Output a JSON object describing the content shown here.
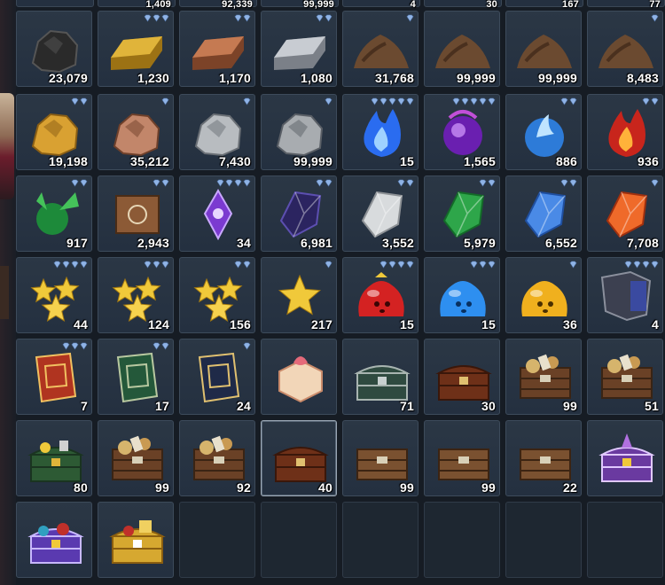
{
  "colors": {
    "slot_bg": "#243040",
    "slot_border": "#3d4b5b",
    "gem": "#8fb3e6",
    "qty": "#ffffff"
  },
  "top_partial": [
    "1,409",
    "92,339",
    "99,999",
    "4",
    "30",
    "167",
    "77"
  ],
  "rows": [
    [
      {
        "icon": "coal-ore-icon",
        "gems": 0,
        "qty": "23,079"
      },
      {
        "icon": "gold-ingot-icon",
        "gems": 3,
        "qty": "1,230"
      },
      {
        "icon": "copper-ingot-icon",
        "gems": 2,
        "qty": "1,170"
      },
      {
        "icon": "silver-ingot-icon",
        "gems": 2,
        "qty": "1,080"
      },
      {
        "icon": "dirt-pile-icon",
        "gems": 1,
        "qty": "31,768"
      },
      {
        "icon": "dirt-pile-icon",
        "gems": 0,
        "qty": "99,999"
      },
      {
        "icon": "dirt-pile-icon",
        "gems": 0,
        "qty": "99,999"
      },
      {
        "icon": "dirt-pile-icon",
        "gems": 1,
        "qty": "8,483"
      }
    ],
    [
      {
        "icon": "gold-ore-icon",
        "gems": 2,
        "qty": "19,198"
      },
      {
        "icon": "copper-ore-icon",
        "gems": 1,
        "qty": "35,212"
      },
      {
        "icon": "silver-ore-icon",
        "gems": 1,
        "qty": "7,430"
      },
      {
        "icon": "iron-ore-icon",
        "gems": 1,
        "qty": "99,999"
      },
      {
        "icon": "blue-flame-icon",
        "gems": 5,
        "qty": "15"
      },
      {
        "icon": "purple-orb-icon",
        "gems": 5,
        "qty": "1,565"
      },
      {
        "icon": "blue-fire-orb-icon",
        "gems": 2,
        "qty": "886"
      },
      {
        "icon": "red-flame-icon",
        "gems": 2,
        "qty": "936"
      }
    ],
    [
      {
        "icon": "green-crystal-icon",
        "gems": 2,
        "qty": "917"
      },
      {
        "icon": "scroll-icon",
        "gems": 2,
        "qty": "2,943"
      },
      {
        "icon": "purple-amulet-icon",
        "gems": 4,
        "qty": "34"
      },
      {
        "icon": "dark-gem-icon",
        "gems": 2,
        "qty": "6,981"
      },
      {
        "icon": "white-gem-icon",
        "gems": 2,
        "qty": "3,552"
      },
      {
        "icon": "green-gem-icon",
        "gems": 2,
        "qty": "5,979"
      },
      {
        "icon": "blue-gem-icon",
        "gems": 2,
        "qty": "6,552"
      },
      {
        "icon": "orange-gem-icon",
        "gems": 1,
        "qty": "7,708"
      }
    ],
    [
      {
        "icon": "star-cluster-icon",
        "gems": 4,
        "qty": "44"
      },
      {
        "icon": "star-cluster-icon",
        "gems": 3,
        "qty": "124"
      },
      {
        "icon": "star-cluster-icon",
        "gems": 2,
        "qty": "156"
      },
      {
        "icon": "gold-star-icon",
        "gems": 1,
        "qty": "217"
      },
      {
        "icon": "red-slime-icon",
        "gems": 4,
        "qty": "15"
      },
      {
        "icon": "blue-slime-icon",
        "gems": 3,
        "qty": "15"
      },
      {
        "icon": "yellow-slime-icon",
        "gems": 1,
        "qty": "36"
      },
      {
        "icon": "armor-banner-icon",
        "gems": 4,
        "qty": "4"
      }
    ],
    [
      {
        "icon": "red-book-icon",
        "gems": 3,
        "qty": "7"
      },
      {
        "icon": "green-book-icon",
        "gems": 2,
        "qty": "17"
      },
      {
        "icon": "dark-book-icon",
        "gems": 1,
        "qty": "24"
      },
      {
        "icon": "gift-box-icon",
        "gems": 0,
        "qty": ""
      },
      {
        "icon": "green-chest-icon",
        "gems": 0,
        "qty": "71"
      },
      {
        "icon": "wood-chest-icon",
        "gems": 0,
        "qty": "30"
      },
      {
        "icon": "loot-crate-icon",
        "gems": 0,
        "qty": "99"
      },
      {
        "icon": "loot-crate-icon",
        "gems": 0,
        "qty": "51"
      }
    ],
    [
      {
        "icon": "green-treasure-chest-icon",
        "gems": 0,
        "qty": "80"
      },
      {
        "icon": "loot-crate-icon",
        "gems": 0,
        "qty": "99"
      },
      {
        "icon": "loot-crate-icon",
        "gems": 0,
        "qty": "92"
      },
      {
        "icon": "wood-chest-icon",
        "gems": 0,
        "qty": "40",
        "selected": true
      },
      {
        "icon": "plain-crate-icon",
        "gems": 0,
        "qty": "99"
      },
      {
        "icon": "plain-crate-icon",
        "gems": 0,
        "qty": "99"
      },
      {
        "icon": "plain-crate-icon",
        "gems": 0,
        "qty": "22"
      },
      {
        "icon": "purple-chest-icon",
        "gems": 0,
        "qty": ""
      }
    ],
    [
      {
        "icon": "purple-treasure-chest-icon",
        "gems": 0,
        "qty": ""
      },
      {
        "icon": "gold-treasure-chest-icon",
        "gems": 0,
        "qty": ""
      },
      {
        "icon": "empty",
        "gems": 0,
        "qty": ""
      },
      {
        "icon": "empty",
        "gems": 0,
        "qty": ""
      },
      {
        "icon": "empty",
        "gems": 0,
        "qty": ""
      },
      {
        "icon": "empty",
        "gems": 0,
        "qty": ""
      },
      {
        "icon": "empty",
        "gems": 0,
        "qty": ""
      },
      {
        "icon": "empty",
        "gems": 0,
        "qty": ""
      }
    ]
  ]
}
